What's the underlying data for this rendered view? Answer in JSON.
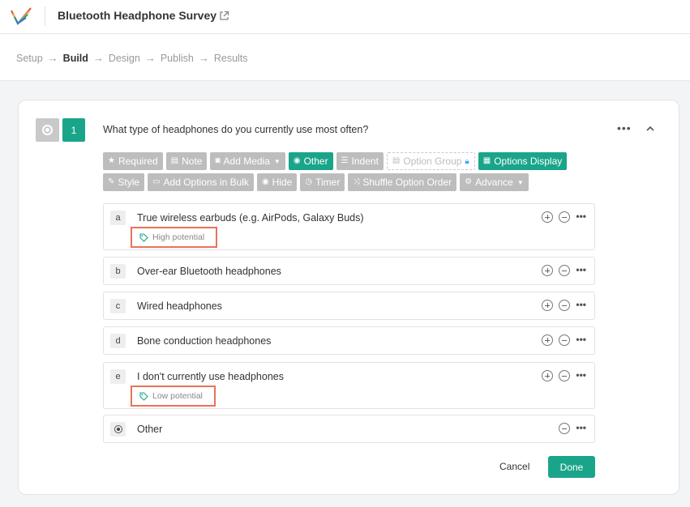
{
  "header": {
    "title": "Bluetooth Headphone Survey"
  },
  "steps": [
    "Setup",
    "Build",
    "Design",
    "Publish",
    "Results"
  ],
  "question": {
    "number": "1",
    "text": "What type of headphones do you currently use most often?"
  },
  "toolbar": [
    {
      "label": "Required",
      "icon": "star-icon",
      "style": "gray"
    },
    {
      "label": "Note",
      "icon": "note-icon",
      "style": "gray"
    },
    {
      "label": "Add Media",
      "icon": "camera-icon",
      "style": "gray",
      "caret": true
    },
    {
      "label": "Other",
      "icon": "radio-icon",
      "style": "teal"
    },
    {
      "label": "Indent",
      "icon": "indent-icon",
      "style": "gray"
    },
    {
      "label": "Option Group",
      "icon": "group-icon",
      "style": "dashed",
      "lock": true
    },
    {
      "label": "Options Display",
      "icon": "grid-icon",
      "style": "teal"
    },
    {
      "label": "Style",
      "icon": "brush-icon",
      "style": "gray"
    },
    {
      "label": "Add Options in Bulk",
      "icon": "document-icon",
      "style": "gray"
    },
    {
      "label": "Hide",
      "icon": "eye-icon",
      "style": "gray"
    },
    {
      "label": "Timer",
      "icon": "clock-icon",
      "style": "gray"
    },
    {
      "label": "Shuffle Option Order",
      "icon": "shuffle-icon",
      "style": "gray"
    },
    {
      "label": "Advance",
      "icon": "gear-icon",
      "style": "gray",
      "caret": true
    }
  ],
  "options": [
    {
      "letter": "a",
      "text": "True wireless earbuds (e.g. AirPods, Galaxy Buds)",
      "tag": "High potential"
    },
    {
      "letter": "b",
      "text": "Over-ear Bluetooth headphones"
    },
    {
      "letter": "c",
      "text": "Wired headphones"
    },
    {
      "letter": "d",
      "text": "Bone conduction headphones"
    },
    {
      "letter": "e",
      "text": "I don't currently use headphones",
      "tag": "Low potential"
    },
    {
      "letter": "",
      "text": "Other",
      "is_other": true
    }
  ],
  "footer": {
    "cancel": "Cancel",
    "done": "Done"
  },
  "colors": {
    "accent": "#1aa58a",
    "toolbar_gray": "#bdbdbd",
    "tag_highlight": "#e8735a"
  }
}
